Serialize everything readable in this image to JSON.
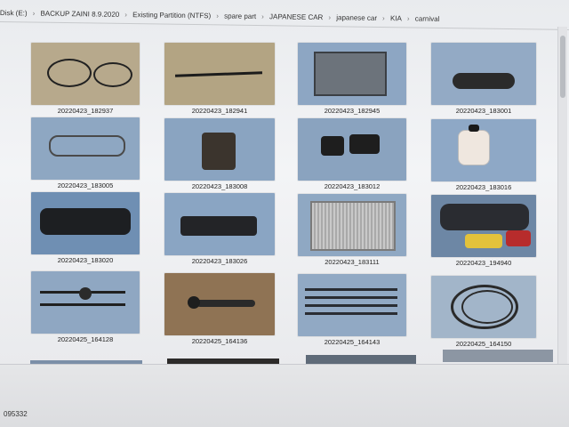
{
  "breadcrumb": [
    "Disk (E:)",
    "BACKUP ZAINI 8.9.2020",
    "Existing Partition (NTFS)",
    "spare part",
    "JAPANESE CAR",
    "japanese car",
    "KIA",
    "carnival"
  ],
  "colors": {
    "screen_bg": "#f1f2f4",
    "tile_tarp_blue": "#8fa9c4",
    "tile_floor_beige": "#b8aa8a",
    "caption": "#222222"
  },
  "thumbnails": [
    {
      "caption": "20220423_182937",
      "icon": "cables-photo",
      "bg": "#b7a98c"
    },
    {
      "caption": "20220423_182941",
      "icon": "rod-photo",
      "bg": "#b3a483"
    },
    {
      "caption": "20220423_182945",
      "icon": "panel-photo",
      "bg": "#8da6c3"
    },
    {
      "caption": "20220423_183001",
      "icon": "mirror-photo",
      "bg": "#93aac5"
    },
    {
      "caption": "20220423_183005",
      "icon": "wiring-photo",
      "bg": "#8ea7c2"
    },
    {
      "caption": "20220423_183008",
      "icon": "bracket-photo",
      "bg": "#8aa4c1"
    },
    {
      "caption": "20220423_183012",
      "icon": "switch-photo",
      "bg": "#8aa3bf"
    },
    {
      "caption": "20220423_183016",
      "icon": "reservoir-photo",
      "bg": "#8ea8c6"
    },
    {
      "caption": "20220423_183020",
      "icon": "cluster-photo",
      "bg": "#6f8fb3"
    },
    {
      "caption": "20220423_183026",
      "icon": "console-photo",
      "bg": "#8aa5c3"
    },
    {
      "caption": "20220423_183111",
      "icon": "radiator-photo",
      "bg": "#8fa8c3"
    },
    {
      "caption": "20220423_194940",
      "icon": "dashboard-photo",
      "bg": "#6d87a5"
    },
    {
      "caption": "20220425_164128",
      "icon": "axles-photo",
      "bg": "#8fa7c2"
    },
    {
      "caption": "20220425_164136",
      "icon": "shaft-photo",
      "bg": "#8f7354"
    },
    {
      "caption": "20220425_164143",
      "icon": "rails-photo",
      "bg": "#91a9c4"
    },
    {
      "caption": "20220425_164150",
      "icon": "hose-photo",
      "bg": "#a2b5c9"
    }
  ],
  "status": {
    "text": "095332"
  }
}
